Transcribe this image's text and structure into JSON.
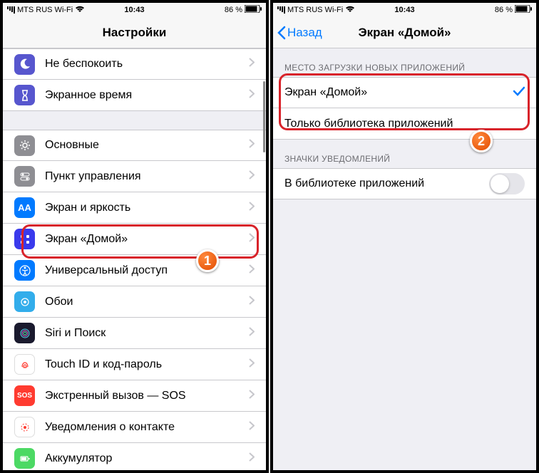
{
  "statusbar": {
    "carrier": "MTS RUS Wi-Fi",
    "time": "10:43",
    "battery": "86 %"
  },
  "leftPanel": {
    "title": "Настройки",
    "group1": [
      {
        "label": "Не беспокоить",
        "icon": "moon",
        "bg": "#5756ce"
      },
      {
        "label": "Экранное время",
        "icon": "hourglass",
        "bg": "#5756ce"
      }
    ],
    "group2": [
      {
        "label": "Основные",
        "icon": "gear",
        "bg": "#8e8e93"
      },
      {
        "label": "Пункт управления",
        "icon": "toggles",
        "bg": "#8e8e93"
      },
      {
        "label": "Экран и яркость",
        "icon": "aa",
        "bg": "#007aff"
      },
      {
        "label": "Экран «Домой»",
        "icon": "grid",
        "bg": "#3a3aec"
      },
      {
        "label": "Универсальный доступ",
        "icon": "access",
        "bg": "#007aff"
      },
      {
        "label": "Обои",
        "icon": "wall",
        "bg": "#32adeb"
      },
      {
        "label": "Siri и Поиск",
        "icon": "siri",
        "bg": "#222"
      },
      {
        "label": "Touch ID и код-пароль",
        "icon": "touch",
        "bg": "#ff3b30"
      },
      {
        "label": "Экстренный вызов — SOS",
        "icon": "sos",
        "bg": "#ff3b30"
      },
      {
        "label": "Уведомления о контакте",
        "icon": "exposure",
        "bg": "#fff"
      },
      {
        "label": "Аккумулятор",
        "icon": "battery",
        "bg": "#4cd964"
      }
    ]
  },
  "rightPanel": {
    "back": "Назад",
    "title": "Экран «Домой»",
    "sec1Header": "МЕСТО ЗАГРУЗКИ НОВЫХ ПРИЛОЖЕНИЙ",
    "sec1": [
      {
        "label": "Экран «Домой»",
        "checked": true
      },
      {
        "label": "Только библиотека приложений",
        "checked": false
      }
    ],
    "sec2Header": "ЗНАЧКИ УВЕДОМЛЕНИЙ",
    "sec2": [
      {
        "label": "В библиотеке приложений",
        "switch": false
      }
    ]
  },
  "markers": {
    "m1": "1",
    "m2": "2"
  }
}
